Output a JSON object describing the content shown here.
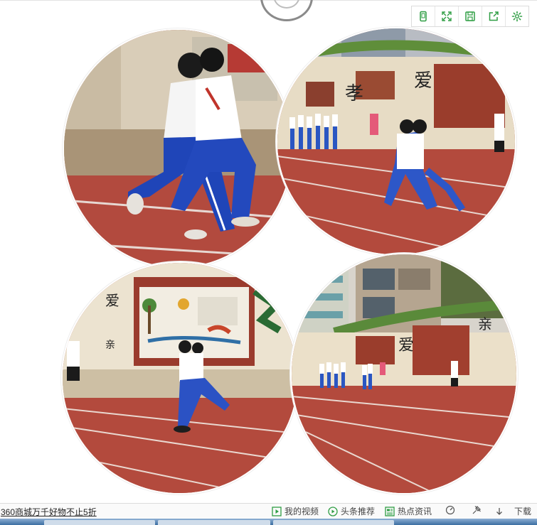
{
  "toolbar": {
    "icons": [
      "tablet-icon",
      "fullscreen-icon",
      "save-icon",
      "share-icon",
      "settings-icon"
    ]
  },
  "photos": [
    {
      "name": "photo-top-left",
      "description_icon": "photo"
    },
    {
      "name": "photo-top-right",
      "description_icon": "photo"
    },
    {
      "name": "photo-bottom-left",
      "description_icon": "photo"
    },
    {
      "name": "photo-bottom-right",
      "description_icon": "photo"
    }
  ],
  "statusbar": {
    "promo": "360商城万千好物不止5折",
    "my_video": "我的视频",
    "headline": "头条推荐",
    "hot_news": "热点资讯",
    "download": "下载"
  },
  "colors": {
    "track": "#b3463a",
    "wall": "#e9ddc8",
    "accent_green": "#2f9e44"
  }
}
